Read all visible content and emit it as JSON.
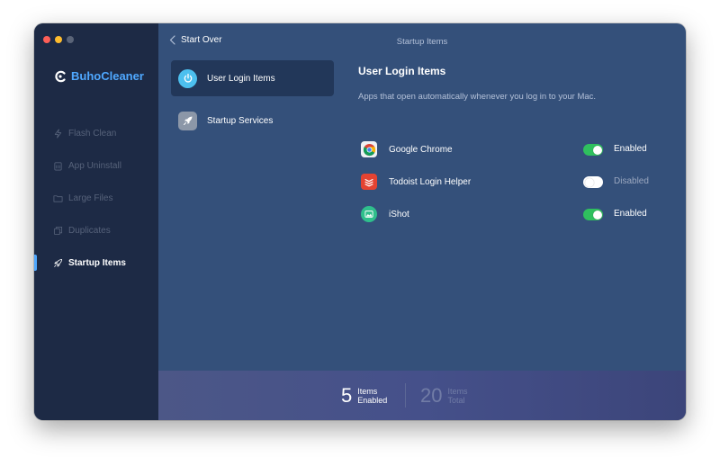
{
  "window": {
    "title": "Startup Items"
  },
  "brand": {
    "name": "BuhoCleaner"
  },
  "sidebar": {
    "items": [
      {
        "label": "Flash Clean",
        "icon": "flash-icon"
      },
      {
        "label": "App Uninstall",
        "icon": "trash-icon"
      },
      {
        "label": "Large Files",
        "icon": "folder-icon"
      },
      {
        "label": "Duplicates",
        "icon": "duplicate-icon"
      },
      {
        "label": "Startup Items",
        "icon": "rocket-icon",
        "active": true
      }
    ]
  },
  "topbar": {
    "back_label": "Start Over"
  },
  "subnav": {
    "items": [
      {
        "label": "User Login Items",
        "icon": "power-icon",
        "active": true
      },
      {
        "label": "Startup Services",
        "icon": "rocket-icon"
      }
    ]
  },
  "content": {
    "title": "User Login Items",
    "description": "Apps that open automatically whenever you log in to your Mac."
  },
  "apps": [
    {
      "name": "Google Chrome",
      "status": "Enabled",
      "enabled": true,
      "icon": "chrome-icon"
    },
    {
      "name": "Todoist Login Helper",
      "status": "Disabled",
      "enabled": false,
      "icon": "todoist-icon"
    },
    {
      "name": "iShot",
      "status": "Enabled",
      "enabled": true,
      "icon": "ishot-icon"
    }
  ],
  "footer": {
    "enabled_count": "5",
    "enabled_label_line1": "Items",
    "enabled_label_line2": "Enabled",
    "total_count": "20",
    "total_label_line1": "Items",
    "total_label_line2": "Total"
  },
  "colors": {
    "accent": "#4fa8ff",
    "toggle_on": "#2fc05e",
    "sidebar_bg": "#1d2a45",
    "main_bg": "#34507a"
  }
}
